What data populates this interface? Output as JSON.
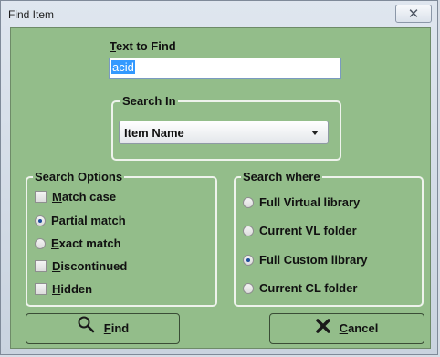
{
  "window": {
    "title": "Find Item"
  },
  "text_to_find": {
    "label_accel": "T",
    "label_rest": "ext to Find",
    "value": "acid"
  },
  "search_in": {
    "legend": "Search In",
    "selected": "Item Name"
  },
  "search_options": {
    "legend": "Search Options",
    "items": [
      {
        "kind": "checkbox",
        "accel": "M",
        "rest": "atch case",
        "checked": false
      },
      {
        "kind": "radio",
        "accel": "P",
        "rest": "artial match",
        "checked": true
      },
      {
        "kind": "radio",
        "accel": "E",
        "rest": "xact match",
        "checked": false
      },
      {
        "kind": "checkbox",
        "accel": "D",
        "rest": "iscontinued",
        "checked": false
      },
      {
        "kind": "checkbox",
        "accel": "H",
        "rest": "idden",
        "checked": false
      }
    ]
  },
  "search_where": {
    "legend": "Search where",
    "items": [
      {
        "label": "Full Virtual library",
        "checked": false
      },
      {
        "label": "Current VL folder",
        "checked": false
      },
      {
        "label": "Full Custom library",
        "checked": true
      },
      {
        "label": "Current CL folder",
        "checked": false
      }
    ]
  },
  "buttons": {
    "find": {
      "accel": "F",
      "rest": "ind",
      "icon": "search-icon"
    },
    "cancel": {
      "accel": "C",
      "rest": "ancel",
      "icon": "cancel-x-icon"
    }
  },
  "colors": {
    "panel": "#93bd8a",
    "selection": "#3399ff"
  }
}
